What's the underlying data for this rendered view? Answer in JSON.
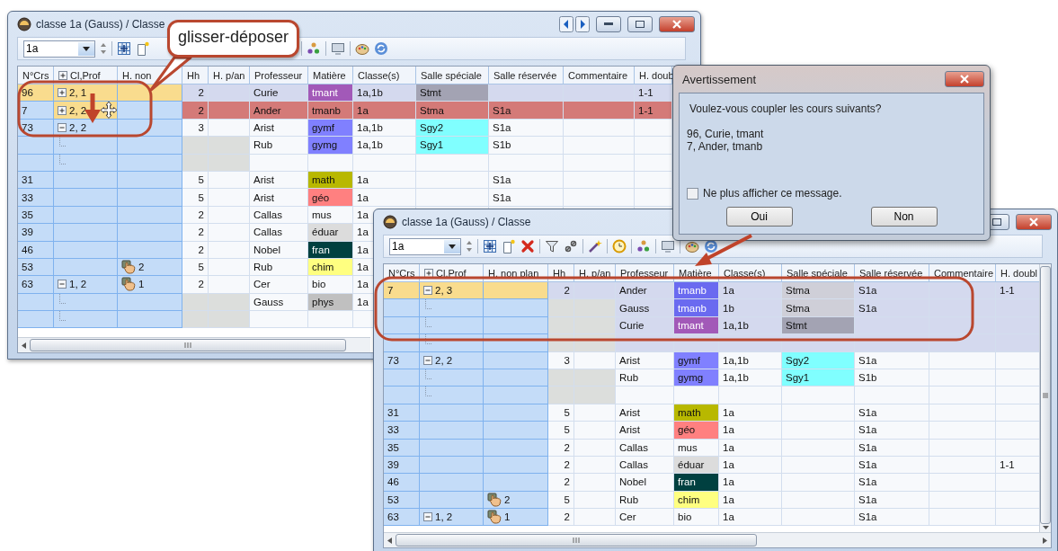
{
  "callout": {
    "text": "glisser-déposer"
  },
  "left_window": {
    "title": "classe 1a (Gauss) / Classe",
    "class_value": "1a",
    "columns": [
      "N°Crs",
      "Cl,Prof",
      "H. non",
      "Hh",
      "H. p/an",
      "Professeur",
      "Matière",
      "Classe(s)",
      "Salle spéciale",
      "Salle réservée",
      "Commentaire",
      "H. doub"
    ],
    "rows": [
      {
        "kind": "group",
        "expanded": false,
        "selected": true,
        "conflict": false,
        "focused": true,
        "marked": false,
        "cells": {
          "nr": "96",
          "group": "2, 1",
          "hh": "2",
          "teacher": "Curie",
          "subject": {
            "text": "tmant",
            "color": "#a259b8"
          },
          "classes": "1a,1b",
          "room": {
            "text": "Stmt",
            "color": "#a3a3b3"
          },
          "double": "1-1"
        }
      },
      {
        "kind": "group",
        "expanded": false,
        "selected": false,
        "conflict": true,
        "focused": false,
        "marked": true,
        "cells": {
          "nr": "7",
          "group": "2, 2",
          "hh": "2",
          "teacher": "Ander",
          "subject": {
            "text": "tmanb"
          },
          "classes": "1a",
          "room": {
            "text": "Stma"
          },
          "reserved": "S1a",
          "double": "1-1"
        }
      },
      {
        "kind": "group",
        "expanded": true,
        "selected": false,
        "conflict": false,
        "focused": false,
        "marked": false,
        "cells": {
          "nr": "73",
          "group": "2, 2",
          "hh": "3",
          "teacher": "Arist",
          "subject": {
            "text": "gymf",
            "color": "#8080ff"
          },
          "classes": "1a,1b",
          "room": {
            "text": "Sgy2",
            "color": "#80ffff"
          },
          "reserved": "S1a"
        }
      },
      {
        "kind": "child",
        "selected": false,
        "conflict": false,
        "focused": false,
        "marked": false,
        "cells": {
          "teacher": "Rub",
          "subject": {
            "text": "gymg",
            "color": "#8080ff"
          },
          "classes": "1a,1b",
          "room": {
            "text": "Sgy1",
            "color": "#80ffff"
          },
          "reserved": "S1b"
        }
      },
      {
        "kind": "blank",
        "selected": false,
        "conflict": false,
        "focused": false,
        "marked": false,
        "cells": {}
      },
      {
        "kind": "course",
        "selected": false,
        "conflict": false,
        "focused": false,
        "marked": false,
        "cells": {
          "nr": "31",
          "hh": "5",
          "teacher": "Arist",
          "subject": {
            "text": "math",
            "color": "#b8b800"
          },
          "classes": "1a",
          "reserved": "S1a"
        }
      },
      {
        "kind": "course",
        "selected": false,
        "conflict": false,
        "focused": false,
        "marked": false,
        "cells": {
          "nr": "33",
          "hh": "5",
          "teacher": "Arist",
          "subject": {
            "text": "géo",
            "color": "#ff8080"
          },
          "classes": "1a",
          "reserved": "S1a"
        }
      },
      {
        "kind": "course",
        "selected": false,
        "conflict": false,
        "focused": false,
        "marked": false,
        "cells": {
          "nr": "35",
          "hh": "2",
          "teacher": "Callas",
          "subject": {
            "text": "mus"
          },
          "classes": "1a"
        }
      },
      {
        "kind": "course",
        "selected": false,
        "conflict": false,
        "focused": false,
        "marked": false,
        "cells": {
          "nr": "39",
          "hh": "2",
          "teacher": "Callas",
          "subject": {
            "text": "éduar",
            "color": "#dcdcdc"
          },
          "classes": "1a"
        }
      },
      {
        "kind": "course",
        "selected": false,
        "conflict": false,
        "focused": false,
        "marked": false,
        "cells": {
          "nr": "46",
          "hh": "2",
          "teacher": "Nobel",
          "subject": {
            "text": "fran",
            "color": "#004040"
          },
          "classes": "1a"
        }
      },
      {
        "kind": "course",
        "selected": false,
        "conflict": false,
        "focused": false,
        "marked": false,
        "hand": true,
        "cells": {
          "nr": "53",
          "unplanned": "2",
          "hh": "5",
          "teacher": "Rub",
          "subject": {
            "text": "chim",
            "color": "#ffff80"
          },
          "classes": "1a"
        }
      },
      {
        "kind": "group",
        "expanded": true,
        "selected": false,
        "conflict": false,
        "focused": false,
        "marked": false,
        "hand": true,
        "cells": {
          "nr": "63",
          "group": "1, 2",
          "unplanned": "1",
          "hh": "2",
          "teacher": "Cer",
          "subject": {
            "text": "bio"
          },
          "classes": "1a"
        }
      },
      {
        "kind": "child",
        "selected": false,
        "conflict": false,
        "focused": false,
        "marked": false,
        "cells": {
          "teacher": "Gauss",
          "subject": {
            "text": "phys",
            "color": "#c0c0c0"
          },
          "classes": "1a"
        }
      },
      {
        "kind": "blank",
        "selected": false,
        "conflict": false,
        "focused": false,
        "marked": false,
        "cells": {}
      }
    ]
  },
  "right_window": {
    "title": "classe 1a (Gauss) / Classe",
    "class_value": "1a",
    "columns": [
      "N°Crs",
      "Cl,Prof",
      "H. non plan",
      "Hh",
      "H. p/an",
      "Professeur",
      "Matière",
      "Classe(s)",
      "Salle spéciale",
      "Salle réservée",
      "Commentaire",
      "H. doubl"
    ],
    "rows": [
      {
        "kind": "group",
        "expanded": true,
        "selected": true,
        "conflict": false,
        "focused": true,
        "marked": false,
        "cells": {
          "nr": "7",
          "group": "2, 3",
          "hh": "2",
          "teacher": "Ander",
          "subject": {
            "text": "tmanb",
            "color": "#6a6af0"
          },
          "classes": "1a",
          "room": {
            "text": "Stma",
            "color": "#cfcfd8"
          },
          "reserved": "S1a",
          "double": "1-1"
        }
      },
      {
        "kind": "child",
        "selected": true,
        "conflict": false,
        "focused": false,
        "marked": false,
        "cells": {
          "teacher": "Gauss",
          "subject": {
            "text": "tmanb",
            "color": "#6a6af0"
          },
          "classes": "1b",
          "room": {
            "text": "Stma",
            "color": "#cfcfd8"
          },
          "reserved": "S1a"
        }
      },
      {
        "kind": "child",
        "selected": true,
        "conflict": false,
        "focused": false,
        "marked": false,
        "cells": {
          "teacher": "Curie",
          "subject": {
            "text": "tmant",
            "color": "#a259b8"
          },
          "classes": "1a,1b",
          "room": {
            "text": "Stmt",
            "color": "#a3a3b3"
          }
        }
      },
      {
        "kind": "blank",
        "selected": true,
        "conflict": false,
        "focused": false,
        "marked": false,
        "cells": {}
      },
      {
        "kind": "group",
        "expanded": true,
        "selected": false,
        "conflict": false,
        "focused": false,
        "marked": false,
        "cells": {
          "nr": "73",
          "group": "2, 2",
          "hh": "3",
          "teacher": "Arist",
          "subject": {
            "text": "gymf",
            "color": "#8080ff"
          },
          "classes": "1a,1b",
          "room": {
            "text": "Sgy2",
            "color": "#80ffff"
          },
          "reserved": "S1a"
        }
      },
      {
        "kind": "child",
        "selected": false,
        "conflict": false,
        "focused": false,
        "marked": false,
        "cells": {
          "teacher": "Rub",
          "subject": {
            "text": "gymg",
            "color": "#8080ff"
          },
          "classes": "1a,1b",
          "room": {
            "text": "Sgy1",
            "color": "#80ffff"
          },
          "reserved": "S1b"
        }
      },
      {
        "kind": "blank",
        "selected": false,
        "conflict": false,
        "focused": false,
        "marked": false,
        "cells": {}
      },
      {
        "kind": "course",
        "selected": false,
        "conflict": false,
        "focused": false,
        "marked": false,
        "cells": {
          "nr": "31",
          "hh": "5",
          "teacher": "Arist",
          "subject": {
            "text": "math",
            "color": "#b8b800"
          },
          "classes": "1a",
          "reserved": "S1a"
        }
      },
      {
        "kind": "course",
        "selected": false,
        "conflict": false,
        "focused": false,
        "marked": false,
        "cells": {
          "nr": "33",
          "hh": "5",
          "teacher": "Arist",
          "subject": {
            "text": "géo",
            "color": "#ff8080"
          },
          "classes": "1a",
          "reserved": "S1a"
        }
      },
      {
        "kind": "course",
        "selected": false,
        "conflict": false,
        "focused": false,
        "marked": false,
        "cells": {
          "nr": "35",
          "hh": "2",
          "teacher": "Callas",
          "subject": {
            "text": "mus"
          },
          "classes": "1a",
          "reserved": "S1a"
        }
      },
      {
        "kind": "course",
        "selected": false,
        "conflict": false,
        "focused": false,
        "marked": false,
        "cells": {
          "nr": "39",
          "hh": "2",
          "teacher": "Callas",
          "subject": {
            "text": "éduar",
            "color": "#dcdcdc"
          },
          "classes": "1a",
          "reserved": "S1a",
          "double": "1-1"
        }
      },
      {
        "kind": "course",
        "selected": false,
        "conflict": false,
        "focused": false,
        "marked": false,
        "cells": {
          "nr": "46",
          "hh": "2",
          "teacher": "Nobel",
          "subject": {
            "text": "fran",
            "color": "#004040"
          },
          "classes": "1a",
          "reserved": "S1a"
        }
      },
      {
        "kind": "course",
        "selected": false,
        "conflict": false,
        "focused": false,
        "marked": false,
        "hand": true,
        "cells": {
          "nr": "53",
          "unplanned": "2",
          "hh": "5",
          "teacher": "Rub",
          "subject": {
            "text": "chim",
            "color": "#ffff80"
          },
          "classes": "1a",
          "reserved": "S1a"
        }
      },
      {
        "kind": "group",
        "expanded": true,
        "selected": false,
        "conflict": false,
        "focused": false,
        "marked": false,
        "hand": true,
        "cells": {
          "nr": "63",
          "group": "1, 2",
          "unplanned": "1",
          "hh": "2",
          "teacher": "Cer",
          "subject": {
            "text": "bio"
          },
          "classes": "1a",
          "reserved": "S1a"
        }
      }
    ]
  },
  "dialog": {
    "title": "Avertissement",
    "message": "Voulez-vous coupler les cours suivants?",
    "lines": [
      "96, Curie, tmant",
      "7, Ander, tmanb"
    ],
    "checkbox": {
      "label": "Ne plus afficher ce message.",
      "checked": false
    },
    "buttons": [
      "Oui",
      "Non"
    ]
  }
}
